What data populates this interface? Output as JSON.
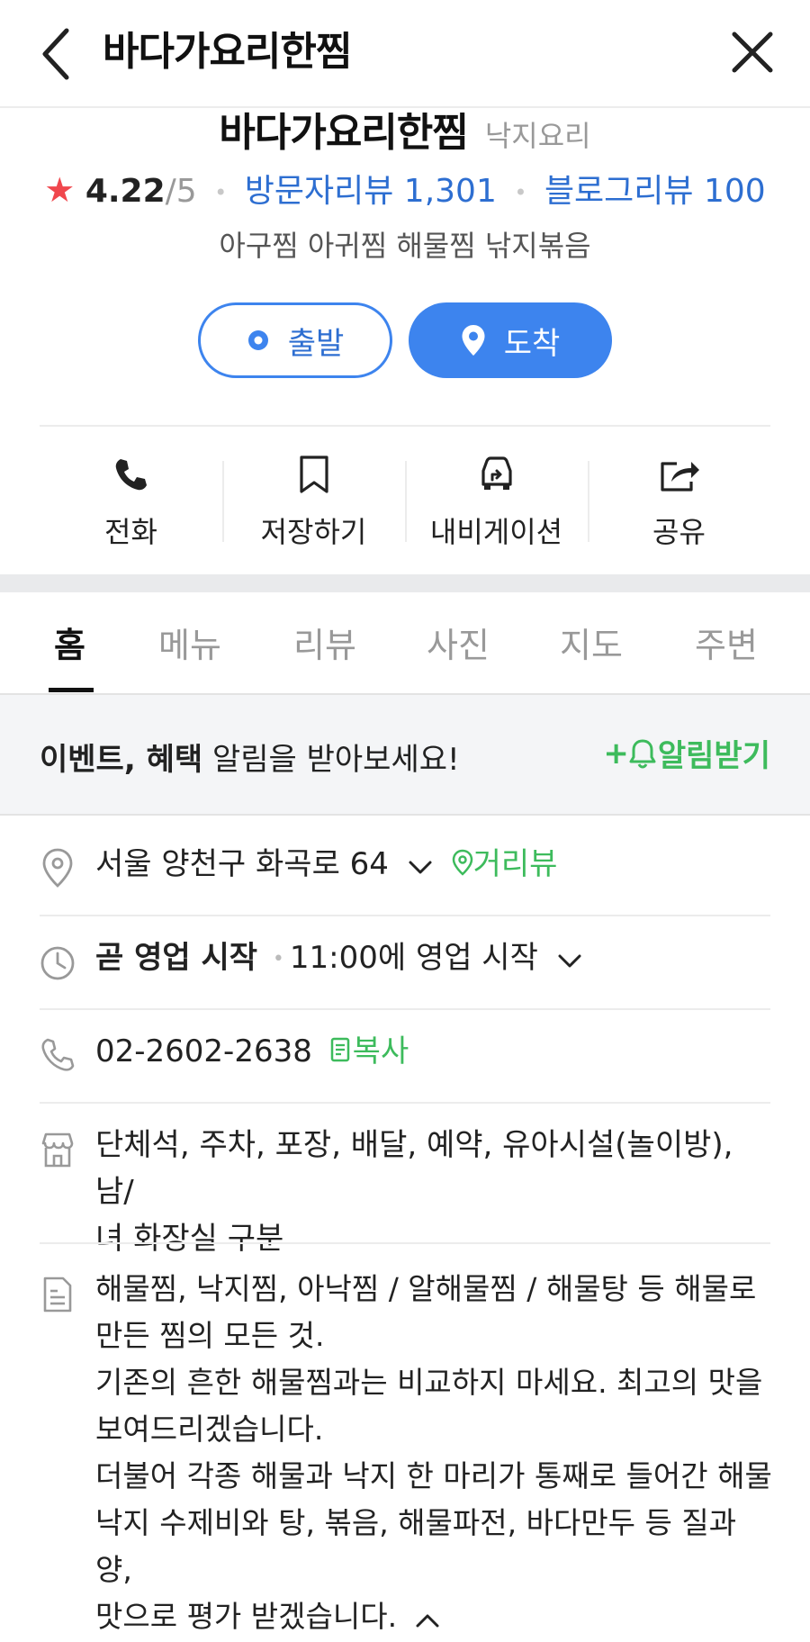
{
  "header": {
    "title": "바다가요리한찜"
  },
  "place": {
    "name": "바다가요리한찜",
    "category": "낙지요리",
    "star": "★",
    "rating": "4.22",
    "rating_max": "/5",
    "visitor_reviews": "방문자리뷰 1,301",
    "blog_reviews": "블로그리뷰 100",
    "tags": "아구찜 아귀찜 해물찜 낚지볶음"
  },
  "buttons": {
    "start": "출발",
    "arrive": "도착"
  },
  "actions": [
    {
      "label": "전화",
      "icon": "phone-icon"
    },
    {
      "label": "저장하기",
      "icon": "bookmark-icon"
    },
    {
      "label": "내비게이션",
      "icon": "car-navigation-icon"
    },
    {
      "label": "공유",
      "icon": "share-icon"
    }
  ],
  "tabs": [
    "홈",
    "메뉴",
    "리뷰",
    "사진",
    "지도",
    "주변"
  ],
  "notice": {
    "bold": "이벤트, 혜택",
    "text": " 알림을 받아보세요!",
    "button": "+알림받기"
  },
  "info": {
    "address": "서울 양천구 화곡로 64",
    "street_view": "거리뷰",
    "hours_status": "곧 영업 시작",
    "hours_detail": "11:00에 영업 시작",
    "phone": "02-2602-2638",
    "copy": "복사",
    "facilities_line1": "단체석, 주차, 포장, 배달, 예약, 유아시설(놀이방), 남/",
    "facilities_line2": "녀 화장실 구분",
    "description": "해물찜, 낙지찜, 아낙찜 / 알해물찜 / 해물탕 등 해물로\n만든 찜의 모든 것.\n기존의 흔한 해물찜과는 비교하지 마세요. 최고의 맛을\n보여드리겠습니다.\n더불어 각종 해물과 낙지 한 마리가 통째로 들어간 해물\n낙지 수제비와 탕, 볶음, 해물파전, 바다만두 등 질과 양,\n맛으로 평가 받겠습니다."
  },
  "colors": {
    "accent_blue": "#3d84ee",
    "link_blue": "#2d6ed1",
    "green": "#3dbb5c",
    "star_red": "#f0474d"
  }
}
